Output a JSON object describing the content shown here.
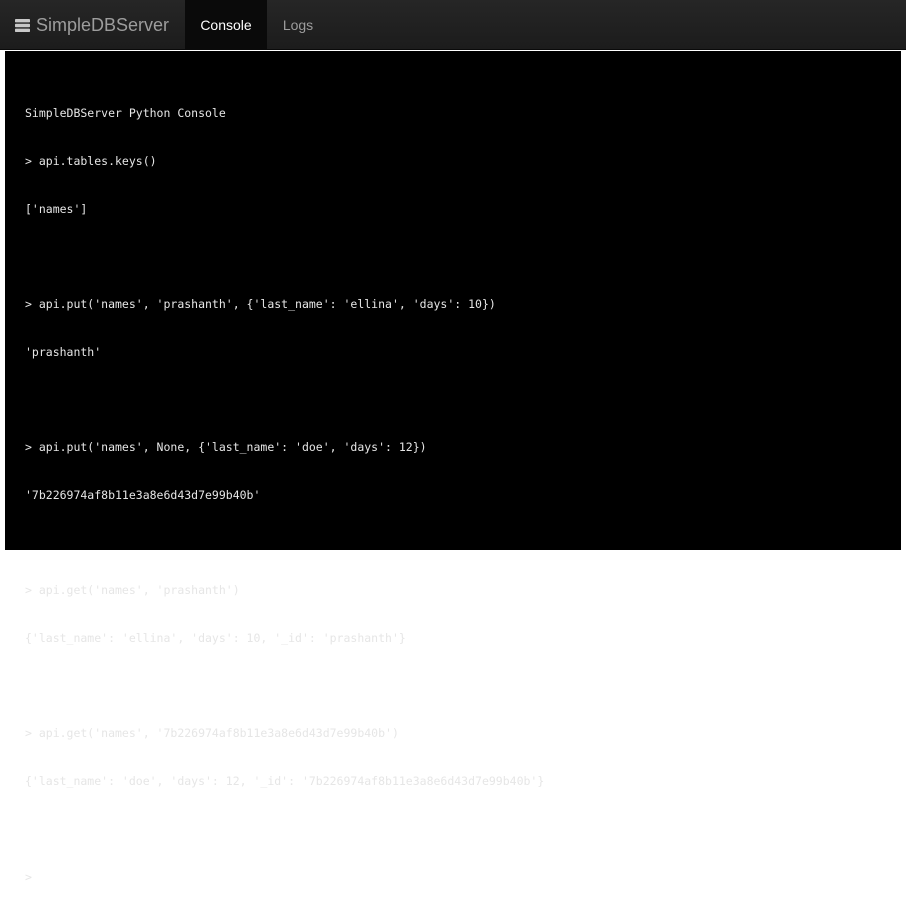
{
  "navbar": {
    "brand": "SimpleDBServer",
    "brand_icon": "database-icon",
    "tabs": [
      {
        "label": "Console",
        "active": true
      },
      {
        "label": "Logs",
        "active": false
      }
    ]
  },
  "console": {
    "banner": "SimpleDBServer Python Console",
    "entries": [
      {
        "input": "> api.tables.keys()",
        "output": "['names']"
      },
      {
        "input": "> api.put('names', 'prashanth', {'last_name': 'ellina', 'days': 10})",
        "output": "'prashanth'"
      },
      {
        "input": "> api.put('names', None, {'last_name': 'doe', 'days': 12})",
        "output": "'7b226974af8b11e3a8e6d43d7e99b40b'"
      },
      {
        "input": "> api.get('names', 'prashanth')",
        "output": "{'last_name': 'ellina', 'days': 10, '_id': 'prashanth'}"
      },
      {
        "input": "> api.get('names', '7b226974af8b11e3a8e6d43d7e99b40b')",
        "output": "{'last_name': 'doe', 'days': 12, '_id': '7b226974af8b11e3a8e6d43d7e99b40b'}"
      }
    ],
    "prompt": ">",
    "input_value": ""
  }
}
